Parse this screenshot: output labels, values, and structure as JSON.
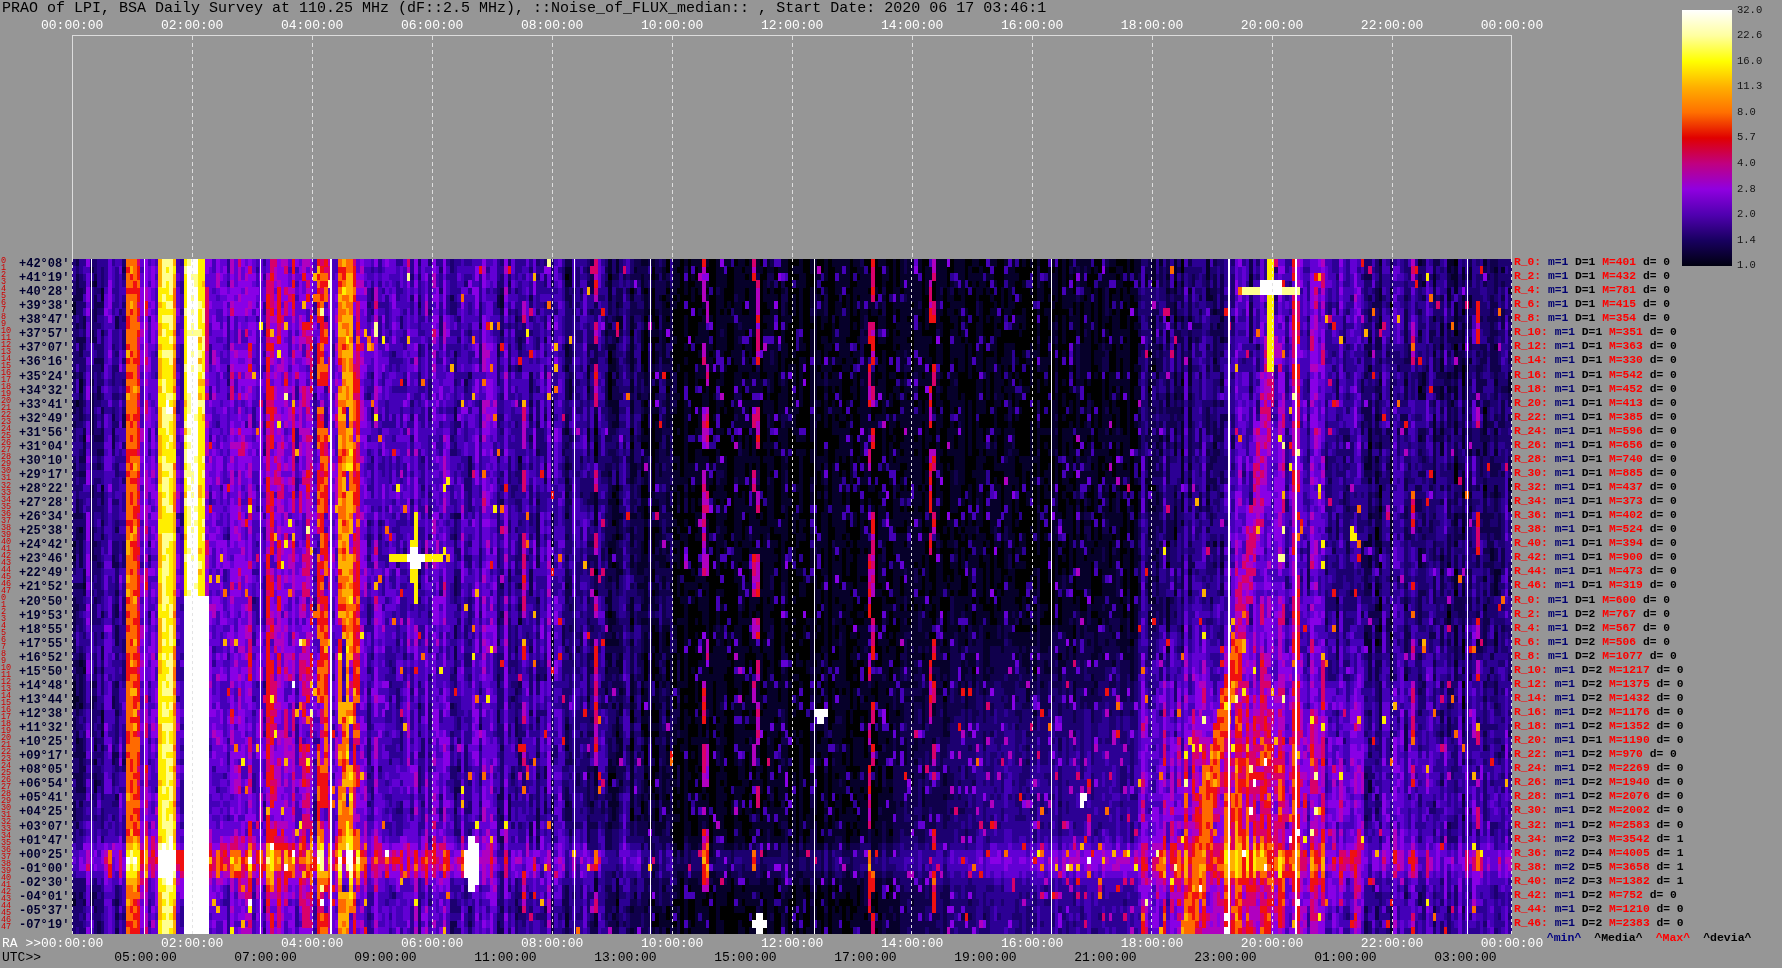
{
  "title": "PRAO of LPI, BSA Daily Survey at 110.25 MHz (dF::2.5 MHz), ::Noise_of_FLUX_median:: , Start Date: 2020 06 17 03:46:1",
  "top_axis": {
    "ticks": [
      "00:00:00",
      "02:00:00",
      "04:00:00",
      "06:00:00",
      "08:00:00",
      "10:00:00",
      "12:00:00",
      "14:00:00",
      "16:00:00",
      "18:00:00",
      "20:00:00",
      "22:00:00",
      "00:00:00"
    ]
  },
  "colorbar": {
    "ticks": [
      "32.0",
      "22.6",
      "16.0",
      "11.3",
      "8.0",
      "5.7",
      "4.0",
      "2.8",
      "2.0",
      "1.4",
      "1.0"
    ]
  },
  "rows": [
    {
      "indices": [
        "0",
        "1"
      ],
      "declination": "+42°08'",
      "name": "R_0:",
      "min": "m=1",
      "median": "D=1",
      "max": "M=401",
      "deviation": "d= 0"
    },
    {
      "indices": [
        "2",
        "3"
      ],
      "declination": "+41°19'",
      "name": "R_2:",
      "min": "m=1",
      "median": "D=1",
      "max": "M=432",
      "deviation": "d= 0"
    },
    {
      "indices": [
        "4",
        "5"
      ],
      "declination": "+40°28'",
      "name": "R_4:",
      "min": "m=1",
      "median": "D=1",
      "max": "M=781",
      "deviation": "d= 0"
    },
    {
      "indices": [
        "6",
        "7"
      ],
      "declination": "+39°38'",
      "name": "R_6:",
      "min": "m=1",
      "median": "D=1",
      "max": "M=415",
      "deviation": "d= 0"
    },
    {
      "indices": [
        "8",
        "9"
      ],
      "declination": "+38°47'",
      "name": "R_8:",
      "min": "m=1",
      "median": "D=1",
      "max": "M=354",
      "deviation": "d= 0"
    },
    {
      "indices": [
        "10",
        "11"
      ],
      "declination": "+37°57'",
      "name": "R_10:",
      "min": "m=1",
      "median": "D=1",
      "max": "M=351",
      "deviation": "d= 0"
    },
    {
      "indices": [
        "12",
        "13"
      ],
      "declination": "+37°07'",
      "name": "R_12:",
      "min": "m=1",
      "median": "D=1",
      "max": "M=363",
      "deviation": "d= 0"
    },
    {
      "indices": [
        "14",
        "15"
      ],
      "declination": "+36°16'",
      "name": "R_14:",
      "min": "m=1",
      "median": "D=1",
      "max": "M=330",
      "deviation": "d= 0"
    },
    {
      "indices": [
        "16",
        "17"
      ],
      "declination": "+35°24'",
      "name": "R_16:",
      "min": "m=1",
      "median": "D=1",
      "max": "M=542",
      "deviation": "d= 0"
    },
    {
      "indices": [
        "18",
        "19"
      ],
      "declination": "+34°32'",
      "name": "R_18:",
      "min": "m=1",
      "median": "D=1",
      "max": "M=452",
      "deviation": "d= 0"
    },
    {
      "indices": [
        "20",
        "21"
      ],
      "declination": "+33°41'",
      "name": "R_20:",
      "min": "m=1",
      "median": "D=1",
      "max": "M=413",
      "deviation": "d= 0"
    },
    {
      "indices": [
        "22",
        "23"
      ],
      "declination": "+32°49'",
      "name": "R_22:",
      "min": "m=1",
      "median": "D=1",
      "max": "M=385",
      "deviation": "d= 0"
    },
    {
      "indices": [
        "24",
        "25"
      ],
      "declination": "+31°56'",
      "name": "R_24:",
      "min": "m=1",
      "median": "D=1",
      "max": "M=596",
      "deviation": "d= 0"
    },
    {
      "indices": [
        "26",
        "27"
      ],
      "declination": "+31°04'",
      "name": "R_26:",
      "min": "m=1",
      "median": "D=1",
      "max": "M=656",
      "deviation": "d= 0"
    },
    {
      "indices": [
        "28",
        "29"
      ],
      "declination": "+30°10'",
      "name": "R_28:",
      "min": "m=1",
      "median": "D=1",
      "max": "M=740",
      "deviation": "d= 0"
    },
    {
      "indices": [
        "30",
        "31"
      ],
      "declination": "+29°17'",
      "name": "R_30:",
      "min": "m=1",
      "median": "D=1",
      "max": "M=885",
      "deviation": "d= 0"
    },
    {
      "indices": [
        "32",
        "33"
      ],
      "declination": "+28°22'",
      "name": "R_32:",
      "min": "m=1",
      "median": "D=1",
      "max": "M=437",
      "deviation": "d= 0"
    },
    {
      "indices": [
        "34",
        "35"
      ],
      "declination": "+27°28'",
      "name": "R_34:",
      "min": "m=1",
      "median": "D=1",
      "max": "M=373",
      "deviation": "d= 0"
    },
    {
      "indices": [
        "36",
        "37"
      ],
      "declination": "+26°34'",
      "name": "R_36:",
      "min": "m=1",
      "median": "D=1",
      "max": "M=402",
      "deviation": "d= 0"
    },
    {
      "indices": [
        "38",
        "39"
      ],
      "declination": "+25°38'",
      "name": "R_38:",
      "min": "m=1",
      "median": "D=1",
      "max": "M=524",
      "deviation": "d= 0"
    },
    {
      "indices": [
        "40",
        "41"
      ],
      "declination": "+24°42'",
      "name": "R_40:",
      "min": "m=1",
      "median": "D=1",
      "max": "M=394",
      "deviation": "d= 0"
    },
    {
      "indices": [
        "42",
        "43"
      ],
      "declination": "+23°46'",
      "name": "R_42:",
      "min": "m=1",
      "median": "D=1",
      "max": "M=900",
      "deviation": "d= 0"
    },
    {
      "indices": [
        "44",
        "45"
      ],
      "declination": "+22°49'",
      "name": "R_44:",
      "min": "m=1",
      "median": "D=1",
      "max": "M=473",
      "deviation": "d= 0"
    },
    {
      "indices": [
        "46",
        "47"
      ],
      "declination": "+21°52'",
      "name": "R_46:",
      "min": "m=1",
      "median": "D=1",
      "max": "M=319",
      "deviation": "d= 0"
    },
    {
      "indices": [
        "0",
        "1"
      ],
      "declination": "+20°50'",
      "name": "R_0:",
      "min": "m=1",
      "median": "D=1",
      "max": "M=600",
      "deviation": "d= 0"
    },
    {
      "indices": [
        "2",
        "3"
      ],
      "declination": "+19°53'",
      "name": "R_2:",
      "min": "m=1",
      "median": "D=2",
      "max": "M=767",
      "deviation": "d= 0"
    },
    {
      "indices": [
        "4",
        "5"
      ],
      "declination": "+18°55'",
      "name": "R_4:",
      "min": "m=1",
      "median": "D=2",
      "max": "M=567",
      "deviation": "d= 0"
    },
    {
      "indices": [
        "6",
        "7"
      ],
      "declination": "+17°55'",
      "name": "R_6:",
      "min": "m=1",
      "median": "D=2",
      "max": "M=506",
      "deviation": "d= 0"
    },
    {
      "indices": [
        "8",
        "9"
      ],
      "declination": "+16°52'",
      "name": "R_8:",
      "min": "m=1",
      "median": "D=2",
      "max": "M=1077",
      "deviation": "d= 0"
    },
    {
      "indices": [
        "10",
        "11"
      ],
      "declination": "+15°50'",
      "name": "R_10:",
      "min": "m=1",
      "median": "D=2",
      "max": "M=1217",
      "deviation": "d= 0"
    },
    {
      "indices": [
        "12",
        "13"
      ],
      "declination": "+14°48'",
      "name": "R_12:",
      "min": "m=1",
      "median": "D=2",
      "max": "M=1375",
      "deviation": "d= 0"
    },
    {
      "indices": [
        "14",
        "15"
      ],
      "declination": "+13°44'",
      "name": "R_14:",
      "min": "m=1",
      "median": "D=2",
      "max": "M=1432",
      "deviation": "d= 0"
    },
    {
      "indices": [
        "16",
        "17"
      ],
      "declination": "+12°38'",
      "name": "R_16:",
      "min": "m=1",
      "median": "D=2",
      "max": "M=1176",
      "deviation": "d= 0"
    },
    {
      "indices": [
        "18",
        "19"
      ],
      "declination": "+11°32'",
      "name": "R_18:",
      "min": "m=1",
      "median": "D=2",
      "max": "M=1352",
      "deviation": "d= 0"
    },
    {
      "indices": [
        "20",
        "21"
      ],
      "declination": "+10°25'",
      "name": "R_20:",
      "min": "m=1",
      "median": "D=1",
      "max": "M=1190",
      "deviation": "d= 0"
    },
    {
      "indices": [
        "22",
        "23"
      ],
      "declination": "+09°17'",
      "name": "R_22:",
      "min": "m=1",
      "median": "D=2",
      "max": "M=970",
      "deviation": "d= 0"
    },
    {
      "indices": [
        "24",
        "25"
      ],
      "declination": "+08°05'",
      "name": "R_24:",
      "min": "m=1",
      "median": "D=2",
      "max": "M=2269",
      "deviation": "d= 0"
    },
    {
      "indices": [
        "26",
        "27"
      ],
      "declination": "+06°54'",
      "name": "R_26:",
      "min": "m=1",
      "median": "D=2",
      "max": "M=1940",
      "deviation": "d= 0"
    },
    {
      "indices": [
        "28",
        "29"
      ],
      "declination": "+05°41'",
      "name": "R_28:",
      "min": "m=1",
      "median": "D=2",
      "max": "M=2076",
      "deviation": "d= 0"
    },
    {
      "indices": [
        "30",
        "31"
      ],
      "declination": "+04°25'",
      "name": "R_30:",
      "min": "m=1",
      "median": "D=2",
      "max": "M=2002",
      "deviation": "d= 0"
    },
    {
      "indices": [
        "32",
        "33"
      ],
      "declination": "+03°07'",
      "name": "R_32:",
      "min": "m=1",
      "median": "D=2",
      "max": "M=2583",
      "deviation": "d= 0"
    },
    {
      "indices": [
        "34",
        "35"
      ],
      "declination": "+01°47'",
      "name": "R_34:",
      "min": "m=2",
      "median": "D=3",
      "max": "M=3542",
      "deviation": "d= 1"
    },
    {
      "indices": [
        "36",
        "37"
      ],
      "declination": "+00°25'",
      "name": "R_36:",
      "min": "m=2",
      "median": "D=4",
      "max": "M=4005",
      "deviation": "d= 1"
    },
    {
      "indices": [
        "38",
        "39"
      ],
      "declination": "-01°00'",
      "name": "R_38:",
      "min": "m=2",
      "median": "D=5",
      "max": "M=3658",
      "deviation": "d= 1"
    },
    {
      "indices": [
        "40",
        "41"
      ],
      "declination": "-02°30'",
      "name": "R_40:",
      "min": "m=2",
      "median": "D=3",
      "max": "M=1382",
      "deviation": "d= 1"
    },
    {
      "indices": [
        "42",
        "43"
      ],
      "declination": "-04°01'",
      "name": "R_42:",
      "min": "m=1",
      "median": "D=2",
      "max": "M=752",
      "deviation": "d= 0"
    },
    {
      "indices": [
        "44",
        "45"
      ],
      "declination": "-05°37'",
      "name": "R_44:",
      "min": "m=1",
      "median": "D=2",
      "max": "M=1210",
      "deviation": "d= 0"
    },
    {
      "indices": [
        "46",
        "47"
      ],
      "declination": "-07°19'",
      "name": "R_46:",
      "min": "m=1",
      "median": "D=2",
      "max": "M=2383",
      "deviation": "d= 0"
    }
  ],
  "legend": [
    {
      "text": "^min^",
      "color": "#000080"
    },
    {
      "text": "^Media^",
      "color": "#000000"
    },
    {
      "text": "^Max^",
      "color": "#ff0000"
    },
    {
      "text": "^devia^",
      "color": "#000000"
    }
  ],
  "bottom_axis": {
    "ra_label": "RA >>",
    "ra_ticks": [
      "00:00:00",
      "02:00:00",
      "04:00:00",
      "06:00:00",
      "08:00:00",
      "10:00:00",
      "12:00:00",
      "14:00:00",
      "16:00:00",
      "18:00:00",
      "20:00:00",
      "22:00:00",
      "00:00:00"
    ],
    "utc_label": "UTC>>",
    "utc_ticks": [
      "05:00:00",
      "07:00:00",
      "09:00:00",
      "11:00:00",
      "13:00:00",
      "15:00:00",
      "17:00:00",
      "19:00:00",
      "21:00:00",
      "23:00:00",
      "01:00:00",
      "03:00:00"
    ]
  }
}
